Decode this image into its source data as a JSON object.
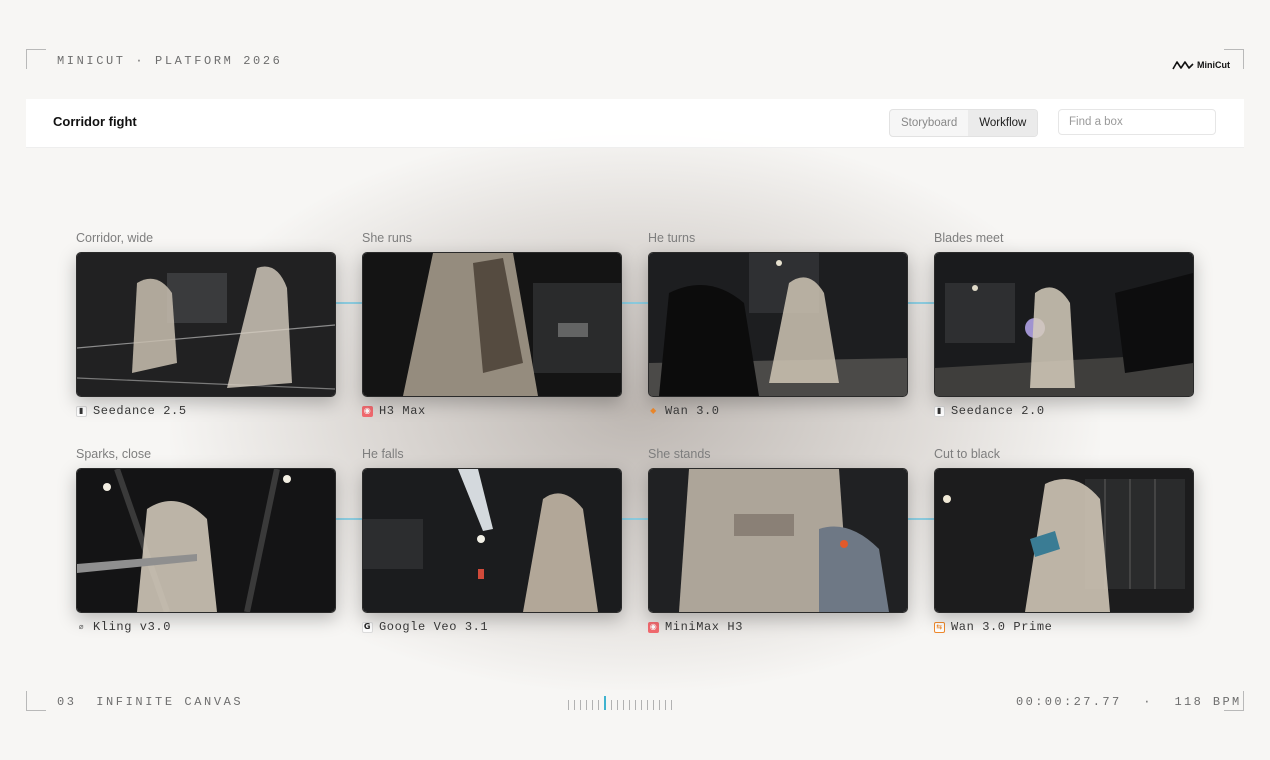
{
  "header": {
    "platform": "MINICUT · PLATFORM 2026",
    "logo_text": "MiniCut",
    "logo_icon": "wave-icon"
  },
  "topbar": {
    "title": "Corridor fight",
    "tabs": [
      {
        "label": "Storyboard",
        "active": false
      },
      {
        "label": "Workflow",
        "active": true
      }
    ],
    "search_placeholder": "Find a box"
  },
  "shots": [
    {
      "label": "Corridor, wide",
      "model": "Seedance 2.5",
      "model_icon": "seedance-icon"
    },
    {
      "label": "She runs",
      "model": "H3 Max",
      "model_icon": "minimax-icon"
    },
    {
      "label": "He turns",
      "model": "Wan 3.0",
      "model_icon": "wan-icon"
    },
    {
      "label": "Blades meet",
      "model": "Seedance 2.0",
      "model_icon": "seedance-icon"
    },
    {
      "label": "Sparks, close",
      "model": "Kling v3.0",
      "model_icon": "kling-icon"
    },
    {
      "label": "He falls",
      "model": "Google Veo 3.1",
      "model_icon": "google-icon"
    },
    {
      "label": "She stands",
      "model": "MiniMax H3",
      "model_icon": "minimax-icon"
    },
    {
      "label": "Cut to black",
      "model": "Wan 3.0 Prime",
      "model_icon": "wan-prime-icon"
    }
  ],
  "footer": {
    "section": "03  INFINITE CANVAS",
    "timecode": "00:00:27.77",
    "separator": "·",
    "bpm": "118 BPM"
  },
  "colors": {
    "accent": "#3fb3cf",
    "connector": "#8fd0e4",
    "background": "#f7f6f4"
  }
}
